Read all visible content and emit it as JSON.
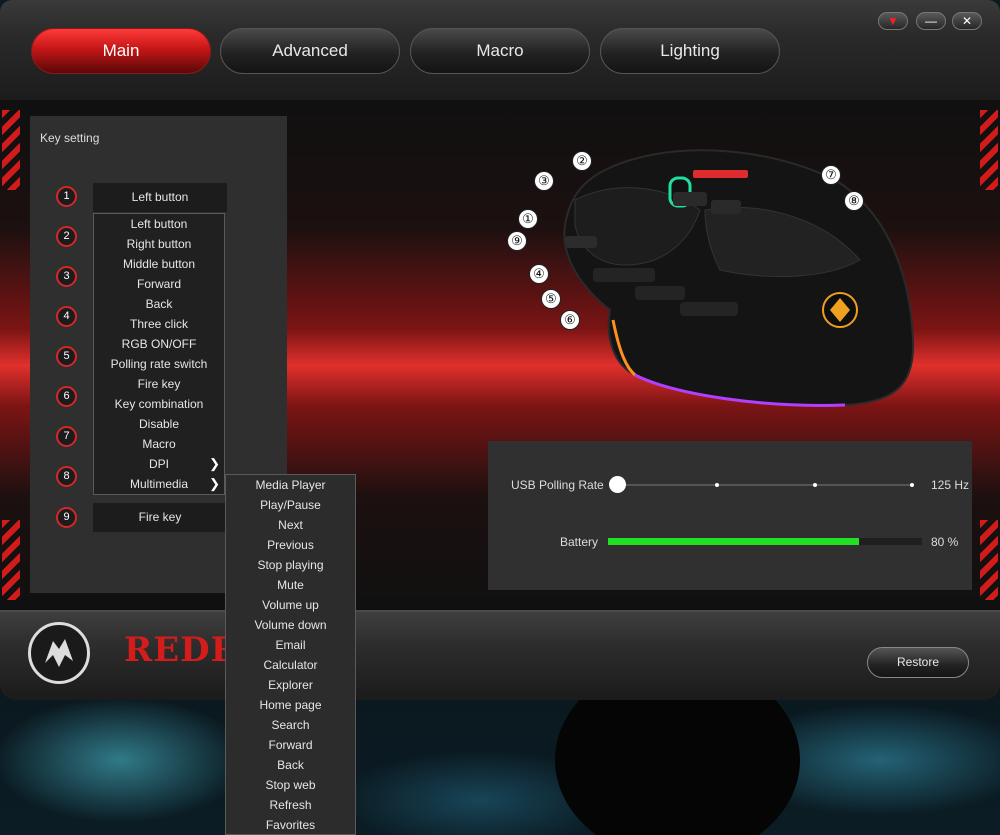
{
  "window_controls": {
    "menu": "▼",
    "minimize": "—",
    "close": "✕"
  },
  "tabs": [
    "Main",
    "Advanced",
    "Macro",
    "Lighting"
  ],
  "key_setting": {
    "title": "Key setting",
    "numbers": [
      "1",
      "2",
      "3",
      "4",
      "5",
      "6",
      "7",
      "8",
      "9"
    ],
    "slot_1_value": "Left button",
    "slot_9_value": "Fire key",
    "dropdown_items": [
      "Left button",
      "Right button",
      "Middle button",
      "Forward",
      "Back",
      "Three click",
      "RGB ON/OFF",
      "Polling rate switch",
      "Fire key",
      "Key combination",
      "Disable",
      "Macro",
      "DPI",
      "Multimedia"
    ],
    "submenu_indicator": "❯",
    "multimedia_items": [
      "Media Player",
      "Play/Pause",
      "Next",
      "Previous",
      "Stop playing",
      "Mute",
      "Volume up",
      "Volume down",
      "Email",
      "Calculator",
      "Explorer",
      "Home page",
      "Search",
      "Forward",
      "Back",
      "Stop web",
      "Refresh",
      "Favorites"
    ]
  },
  "mouse_callouts": [
    "①",
    "②",
    "③",
    "④",
    "⑤",
    "⑥",
    "⑦",
    "⑧",
    "⑨"
  ],
  "polling": {
    "label": "USB Polling Rate",
    "value": "125 Hz",
    "position": 0
  },
  "battery": {
    "label": "Battery",
    "value": "80 %",
    "level": 0.8
  },
  "footer": {
    "brand": "REDRAGON",
    "restore": "Restore"
  },
  "colors": {
    "accent": "#d21c1c",
    "battery": "#22e122"
  }
}
